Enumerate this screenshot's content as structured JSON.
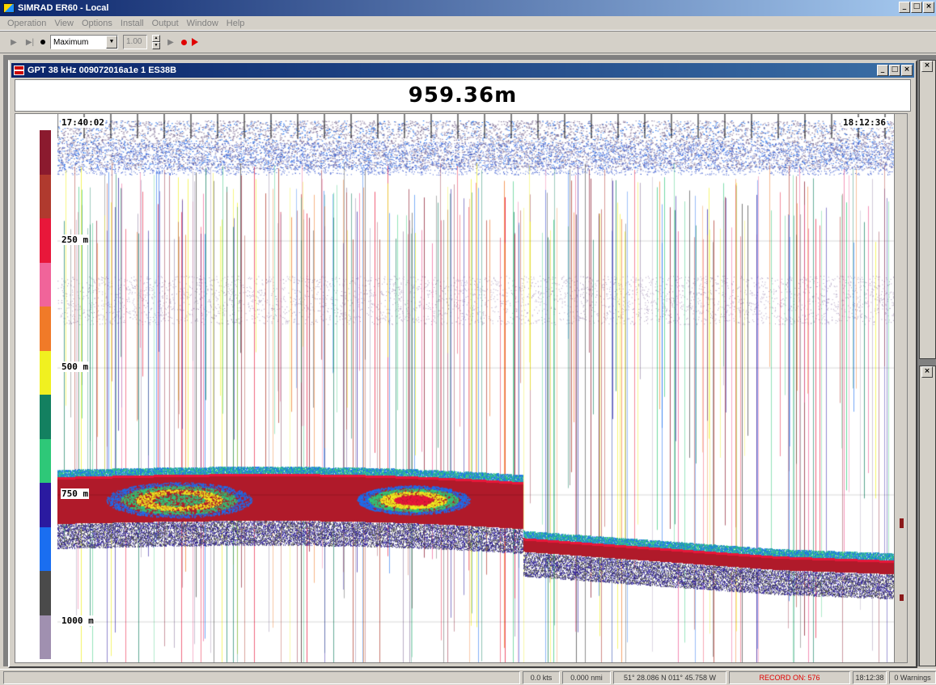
{
  "window": {
    "title": "SIMRAD ER60 - Local",
    "min": "_",
    "max": "□",
    "close": "×"
  },
  "menu": [
    "Operation",
    "View",
    "Options",
    "Install",
    "Output",
    "Window",
    "Help"
  ],
  "toolbar": {
    "ping_mode": "Maximum",
    "interval": "1.00"
  },
  "echogram": {
    "title": "GPT  38 kHz 009072016a1e 1 ES38B",
    "bottom_depth": "959.36m",
    "start_time": "17:40:02",
    "end_time": "18:12:36",
    "depth_labels": [
      {
        "text": "250 m",
        "depth": 250
      },
      {
        "text": "500 m",
        "depth": 500
      },
      {
        "text": "750 m",
        "depth": 750
      },
      {
        "text": "1000 m",
        "depth": 1000
      }
    ],
    "color_scale": [
      "#8b1a2e",
      "#b03a2e",
      "#e8173a",
      "#f0649a",
      "#f07a28",
      "#f0f020",
      "#138060",
      "#2ec878",
      "#2a1aa0",
      "#1a6ef0",
      "#4a4a4a",
      "#a090b0"
    ],
    "bottom_color": "#b01a2a"
  },
  "status": {
    "speed": "0.0 kts",
    "distance": "0.000 nmi",
    "position": "51° 28.086 N  011° 45.758 W",
    "record": "RECORD ON: 576",
    "time": "18:12:38",
    "warnings": "0 Warnings"
  }
}
